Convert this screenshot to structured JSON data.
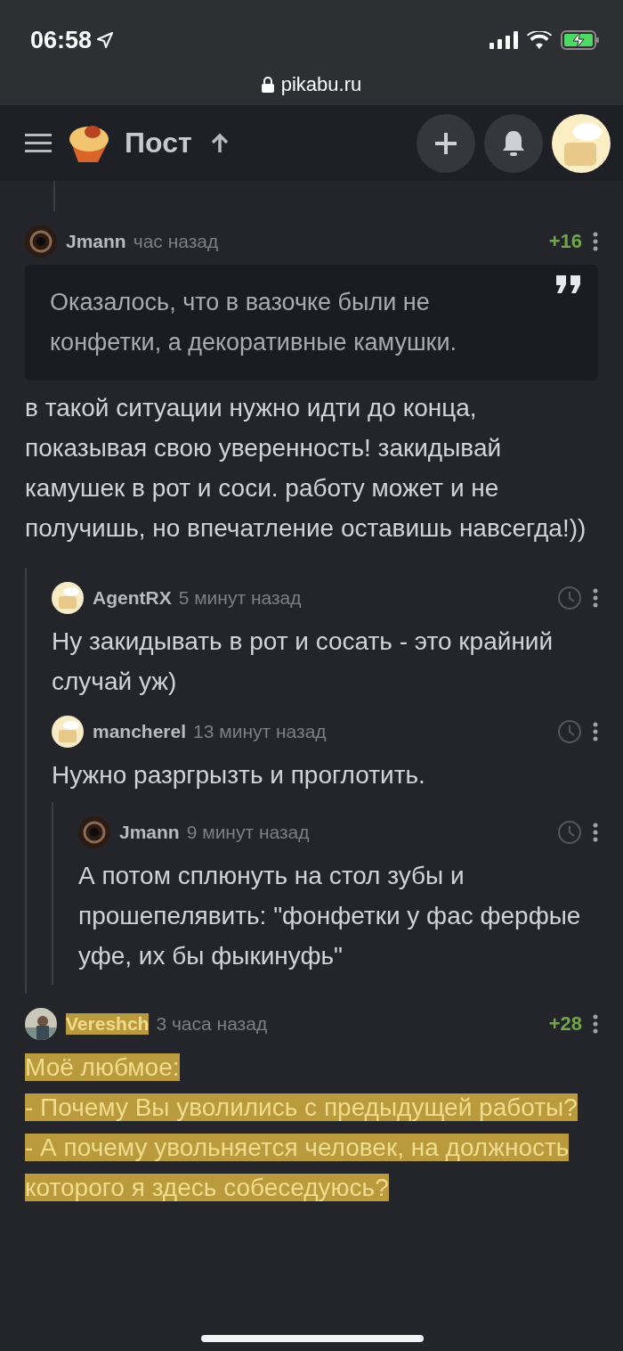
{
  "status_bar": {
    "time": "06:58"
  },
  "browser": {
    "url": "pikabu.ru"
  },
  "header": {
    "title": "Пост"
  },
  "comments": [
    {
      "author": "Jmann",
      "kind": "dark",
      "time": "час назад",
      "rating": "+16",
      "quote": "Оказалось, что в вазочке были не конфетки, а декоративные камушки.",
      "paragraphs": [
        "в такой ситуации нужно идти до конца, показывая свою уверенность! закидывай камушек в рот и соси. работу может и не получишь, но впечатление оставишь навсегда!))"
      ],
      "highlighted": false,
      "children": [
        {
          "author": "AgentRX",
          "kind": "chef",
          "time": "5 минут назад",
          "paragraphs": [
            "Ну закидывать в рот и сосать - это крайний случай уж)"
          ],
          "highlighted": false
        },
        {
          "author": "mancherel",
          "kind": "chef",
          "time": "13 минут назад",
          "paragraphs": [
            "Нужно разргрызть и проглотить."
          ],
          "highlighted": false,
          "children": [
            {
              "author": "Jmann",
              "kind": "dark",
              "time": "9 минут назад",
              "paragraphs": [
                "А потом сплюнуть на стол зубы и прошепелявить: \"фонфетки у фас ферфые уфе, их бы фыкинуфь\""
              ],
              "highlighted": false
            }
          ]
        }
      ]
    },
    {
      "author": "Vereshch",
      "time": "3 часа назад",
      "rating": "+28",
      "paragraphs": [
        "Моё любмое:",
        "- Почему Вы уволились с предыдущей работы?",
        "- А почему увольняется человек, на должность которого я здесь собеседуюсь?"
      ],
      "highlighted": true
    }
  ]
}
